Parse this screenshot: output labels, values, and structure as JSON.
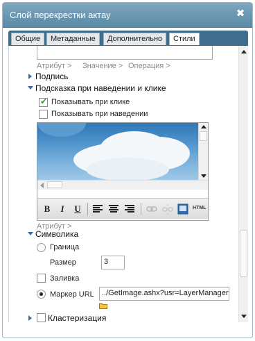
{
  "window": {
    "title": "Слой перекрестки актау",
    "close_glyph": "✖"
  },
  "tabs": [
    "Общие",
    "Метаданные",
    "Дополнительно",
    "Стили"
  ],
  "active_tab": "Стили",
  "filter_breadcrumb": {
    "attribute": "Атрибут >",
    "value": "Значение >",
    "operation": "Операция >"
  },
  "sections": {
    "signature": "Подпись",
    "tooltip": "Подсказка при наведении и клике",
    "symbols": "Символика",
    "clustering": "Кластеризация"
  },
  "tooltip": {
    "show_on_click": "Показывать при клике",
    "show_on_click_checked": true,
    "show_on_hover": "Показывать при наведении",
    "show_on_hover_checked": false,
    "editor_toolbar": {
      "bold": "B",
      "italic": "I",
      "underline": "U",
      "html": "HTML"
    },
    "attribute_link": "Атрибут >"
  },
  "symbols": {
    "border_label": "Граница",
    "size_label": "Размер",
    "size_value": "3",
    "fill_label": "Заливка",
    "marker_label": "Маркер URL",
    "marker_url": "../GetImage.ashx?usr=LayerManager"
  },
  "colors": {
    "titlebar": "#6a96b2",
    "tabbar": "#3f6e8c",
    "accent_triangle": "#3a6ea5"
  }
}
